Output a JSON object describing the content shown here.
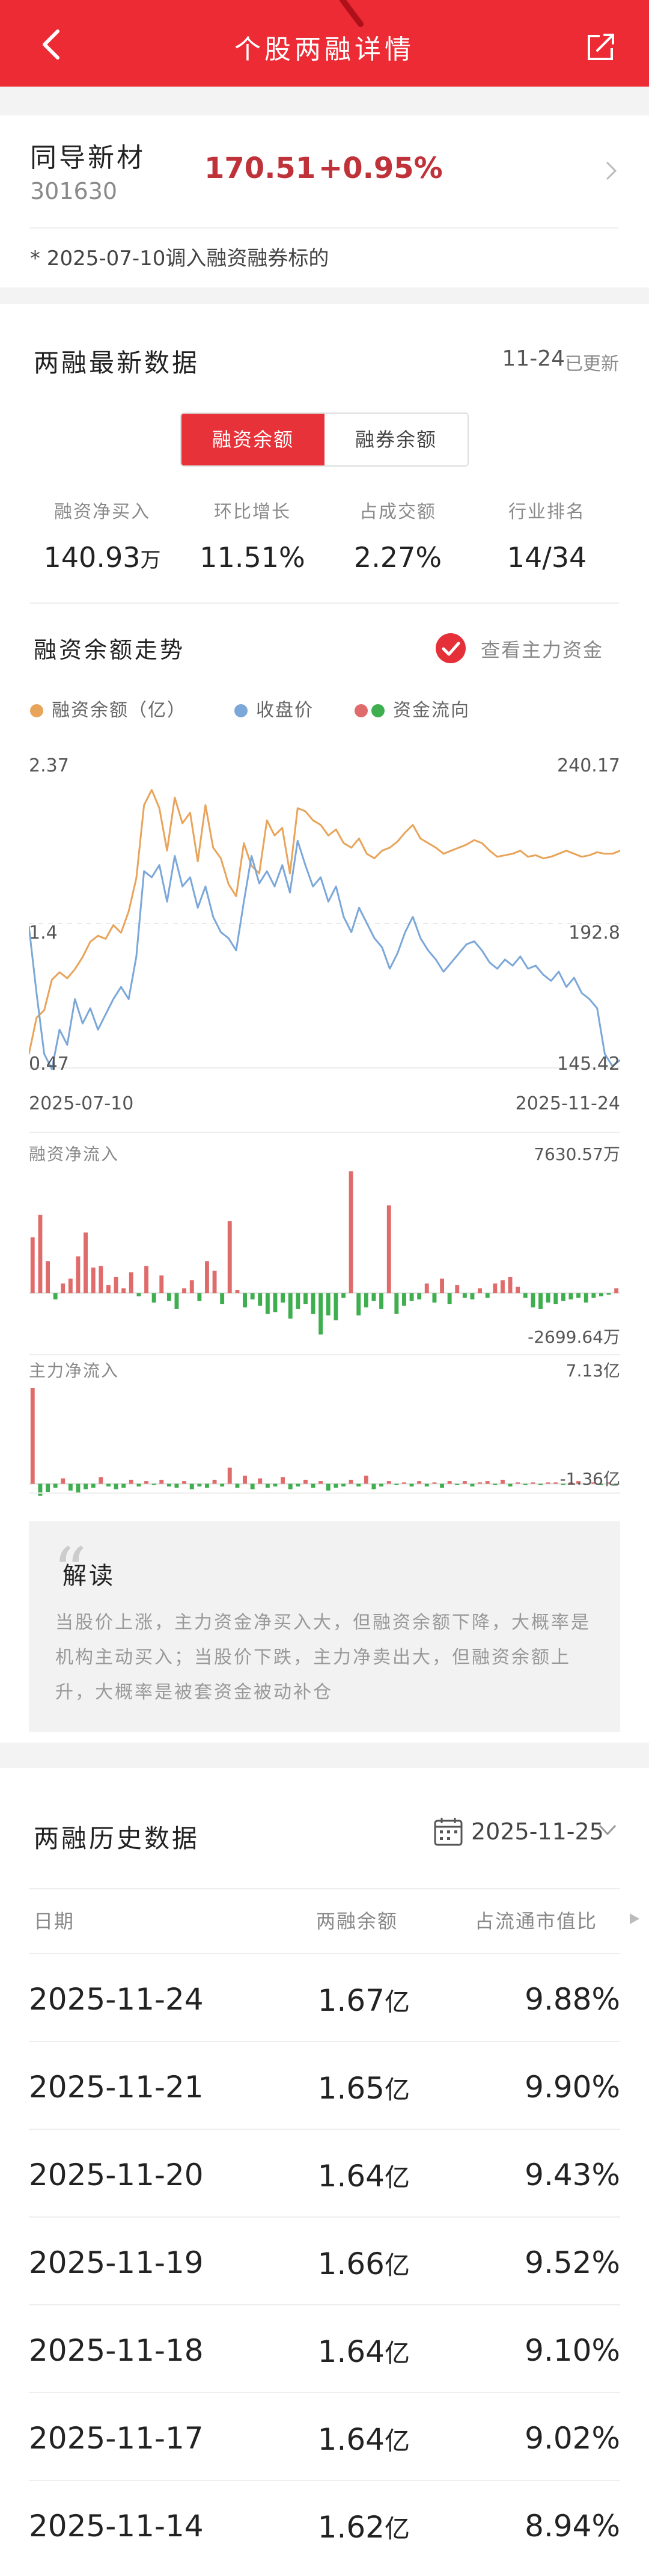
{
  "header": {
    "title": "个股两融详情"
  },
  "stock": {
    "name": "同导新材",
    "code": "301630",
    "price": "170.51",
    "change": "+0.95%",
    "note": "* 2025-07-10调入融资融券标的"
  },
  "latest": {
    "title": "两融最新数据",
    "date": "11-24",
    "updated_label": "已更新",
    "tabs": [
      "融资余额",
      "融券余额"
    ],
    "stats": [
      {
        "label": "融资净买入",
        "value": "140.93",
        "unit": "万"
      },
      {
        "label": "环比增长",
        "value": "11.51%",
        "unit": ""
      },
      {
        "label": "占成交额",
        "value": "2.27%",
        "unit": ""
      },
      {
        "label": "行业排名",
        "value": "14/34",
        "unit": ""
      }
    ]
  },
  "trend": {
    "title": "融资余额走势",
    "check_label": "查看主力资金",
    "legend": [
      "融资余额（亿）",
      "收盘价",
      "资金流向"
    ],
    "colors": {
      "balance": "#e8a45a",
      "close": "#7ba7d9",
      "inflow": "#e06b6b",
      "outflow": "#3fae4f"
    }
  },
  "chart_data": [
    {
      "type": "line",
      "series": [
        {
          "name": "融资余额（亿）",
          "values": [
            0.56,
            0.8,
            0.85,
            1.05,
            1.1,
            1.06,
            1.12,
            1.2,
            1.3,
            1.34,
            1.32,
            1.41,
            1.36,
            1.5,
            1.72,
            2.2,
            2.3,
            2.18,
            1.9,
            2.25,
            2.08,
            2.15,
            1.83,
            2.2,
            1.92,
            1.85,
            1.68,
            1.6,
            1.95,
            1.8,
            1.75,
            2.1,
            2.0,
            2.05,
            1.75,
            2.18,
            2.16,
            2.1,
            2.07,
            2.0,
            2.04,
            1.95,
            1.92,
            1.98,
            1.88,
            1.85,
            1.9,
            1.92,
            1.96,
            2.02,
            2.07,
            1.98,
            1.95,
            1.92,
            1.88,
            1.9,
            1.92,
            1.94,
            1.97,
            1.95,
            1.9,
            1.86,
            1.87,
            1.88,
            1.9,
            1.86,
            1.87,
            1.85,
            1.86,
            1.88,
            1.9,
            1.88,
            1.86,
            1.87,
            1.89,
            1.88,
            1.88,
            1.9
          ]
        },
        {
          "name": "收盘价",
          "values": [
            192,
            170,
            150,
            145,
            158,
            153,
            168,
            160,
            165,
            158,
            163,
            168,
            172,
            168,
            182,
            210,
            208,
            212,
            200,
            215,
            205,
            208,
            198,
            205,
            195,
            190,
            188,
            184,
            200,
            215,
            206,
            210,
            205,
            212,
            203,
            220,
            212,
            205,
            208,
            200,
            205,
            195,
            190,
            198,
            193,
            188,
            185,
            178,
            183,
            190,
            195,
            188,
            184,
            181,
            177,
            180,
            183,
            186,
            187,
            184,
            180,
            178,
            181,
            179,
            182,
            178,
            179,
            176,
            174,
            177,
            172,
            175,
            170,
            168,
            165,
            150,
            146,
            148
          ]
        }
      ],
      "yleft_range": [
        0.47,
        2.37
      ],
      "yleft_ticks": [
        "2.37",
        "1.4",
        "0.47"
      ],
      "yright_range": [
        145.42,
        240.17
      ],
      "yright_ticks": [
        "240.17",
        "192.8",
        "145.42"
      ],
      "x_start": "2025-07-10",
      "x_end": "2025-11-24"
    },
    {
      "type": "bar",
      "title": "融资净流入",
      "max_label": "7630.57万",
      "min_label": "-2699.64万",
      "range": [
        -2699.64,
        7630.57
      ],
      "values": [
        3500,
        4900,
        2000,
        -400,
        600,
        900,
        2300,
        3800,
        1600,
        1700,
        500,
        1000,
        300,
        1300,
        -200,
        1700,
        -600,
        1100,
        -500,
        -1000,
        300,
        800,
        -500,
        2000,
        1400,
        -700,
        4500,
        200,
        -900,
        -400,
        -800,
        -1300,
        -1200,
        -600,
        -1600,
        -1000,
        -700,
        -1300,
        -2600,
        -1400,
        -1700,
        -300,
        7630,
        -1400,
        -900,
        -500,
        -1000,
        5500,
        -1300,
        -800,
        -500,
        -400,
        600,
        -600,
        900,
        -700,
        500,
        -300,
        -400,
        300,
        -300,
        600,
        800,
        1000,
        400,
        -300,
        -900,
        -1000,
        -600,
        -700,
        -500,
        -400,
        -300,
        -600,
        -300,
        -200,
        -100,
        300
      ]
    },
    {
      "type": "bar",
      "title": "主力净流入",
      "max_label": "7.13亿",
      "min_label": "-1.36亿",
      "range": [
        -1.36,
        7.13
      ],
      "values": [
        7.13,
        -0.9,
        -0.6,
        -0.3,
        0.4,
        -0.5,
        -0.7,
        -0.4,
        -0.3,
        0.5,
        -0.2,
        -0.4,
        -0.3,
        0.3,
        -0.2,
        0.2,
        -0.1,
        0.3,
        -0.2,
        -0.3,
        0.2,
        -0.4,
        -0.2,
        -0.3,
        0.3,
        -0.2,
        1.2,
        -0.3,
        0.6,
        -0.4,
        0.4,
        -0.3,
        -0.2,
        0.5,
        -0.4,
        -0.2,
        0.3,
        -0.3,
        0.2,
        -0.5,
        -0.3,
        -0.2,
        0.3,
        -0.2,
        0.6,
        -0.4,
        -0.2,
        0.2,
        -0.1,
        0.1,
        -0.2,
        0.2,
        -0.2,
        0.1,
        -0.3,
        0.2,
        -0.1,
        0.2,
        -0.2,
        0.1,
        0.2,
        -0.1,
        0.3,
        -0.2,
        0.1,
        -0.1,
        0.1,
        -0.1,
        0.1,
        0.1,
        -0.1,
        0.1,
        0.2,
        -0.1,
        0.1,
        -0.1,
        0.1,
        -0.1
      ]
    }
  ],
  "reading": {
    "title": "解读",
    "body": "当股价上涨，主力资金净买入大，但融资余额下降，大概率是机构主动买入；当股价下跌，主力净卖出大，但融资余额上升，大概率是被套资金被动补仓"
  },
  "history": {
    "title": "两融历史数据",
    "date": "2025-11-25",
    "headers": [
      "日期",
      "两融余额",
      "占流通市值比"
    ],
    "unit": "亿",
    "rows": [
      {
        "date": "2025-11-24",
        "balance": "1.67",
        "ratio": "9.88%"
      },
      {
        "date": "2025-11-21",
        "balance": "1.65",
        "ratio": "9.90%"
      },
      {
        "date": "2025-11-20",
        "balance": "1.64",
        "ratio": "9.43%"
      },
      {
        "date": "2025-11-19",
        "balance": "1.66",
        "ratio": "9.52%"
      },
      {
        "date": "2025-11-18",
        "balance": "1.64",
        "ratio": "9.10%"
      },
      {
        "date": "2025-11-17",
        "balance": "1.64",
        "ratio": "9.02%"
      },
      {
        "date": "2025-11-14",
        "balance": "1.62",
        "ratio": "8.94%"
      }
    ]
  },
  "icons": {
    "back": "back-arrow-icon",
    "share": "share-icon",
    "calendar": "calendar-icon",
    "chevron": "chevron-down-icon"
  }
}
